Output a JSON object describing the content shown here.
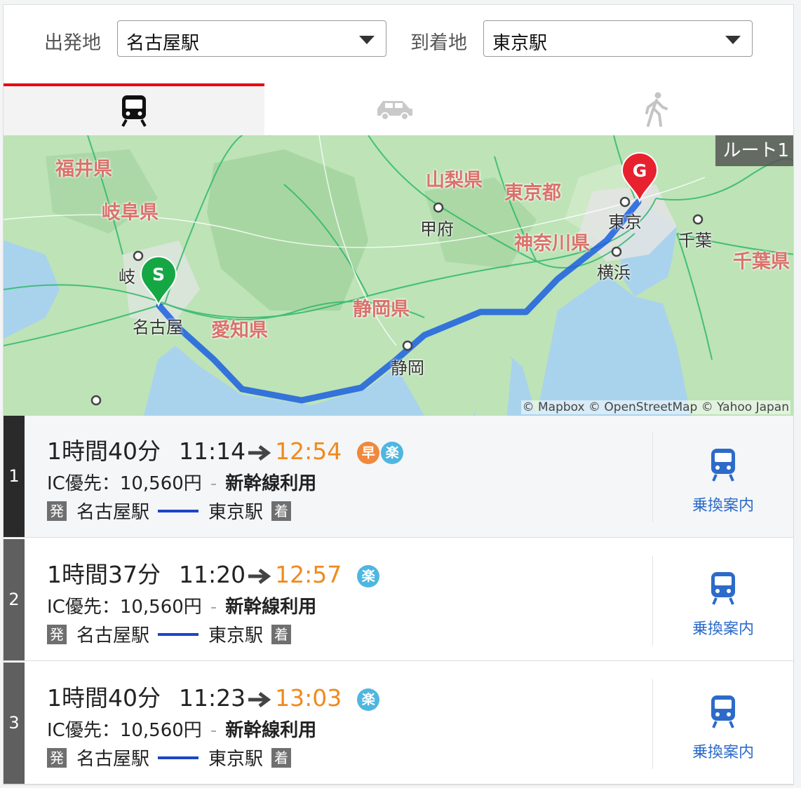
{
  "search": {
    "origin_label": "出発地",
    "origin_value": "名古屋駅",
    "destination_label": "到着地",
    "destination_value": "東京駅"
  },
  "tabs": [
    {
      "name": "train",
      "icon": "train-icon",
      "active": true
    },
    {
      "name": "car",
      "icon": "car-icon",
      "active": false
    },
    {
      "name": "walk",
      "icon": "walk-icon",
      "active": false
    }
  ],
  "colors": {
    "accent": "#e60012",
    "arrival_time": "#f08a1c",
    "route_line": "#1b46c8",
    "link": "#2c6bc9"
  },
  "map": {
    "route_badge": "ルート1",
    "attribution": "© Mapbox © OpenStreetMap © Yahoo Japan",
    "start_marker": "S",
    "goal_marker": "G",
    "prefectures": [
      "福井県",
      "岐阜県",
      "山梨県",
      "東京都",
      "神奈川県",
      "千葉県",
      "静岡県",
      "愛知県"
    ],
    "cities": [
      "甲府",
      "東京",
      "千葉",
      "横浜",
      "岐",
      "名古屋",
      "静岡"
    ]
  },
  "routes": [
    {
      "rank": "1",
      "duration": "1時間40分",
      "depart": "11:14",
      "arrive": "12:54",
      "badges": [
        "早",
        "楽"
      ],
      "fare_label": "IC優先：10,560円",
      "feature": "新幹線利用",
      "dep_tag": "発",
      "from": "名古屋駅",
      "to": "東京駅",
      "arr_tag": "着",
      "transfer_label": "乗換案内"
    },
    {
      "rank": "2",
      "duration": "1時間37分",
      "depart": "11:20",
      "arrive": "12:57",
      "badges": [
        "楽"
      ],
      "fare_label": "IC優先：10,560円",
      "feature": "新幹線利用",
      "dep_tag": "発",
      "from": "名古屋駅",
      "to": "東京駅",
      "arr_tag": "着",
      "transfer_label": "乗換案内"
    },
    {
      "rank": "3",
      "duration": "1時間40分",
      "depart": "11:23",
      "arrive": "13:03",
      "badges": [
        "楽"
      ],
      "fare_label": "IC優先：10,560円",
      "feature": "新幹線利用",
      "dep_tag": "発",
      "from": "名古屋駅",
      "to": "東京駅",
      "arr_tag": "着",
      "transfer_label": "乗換案内"
    }
  ]
}
